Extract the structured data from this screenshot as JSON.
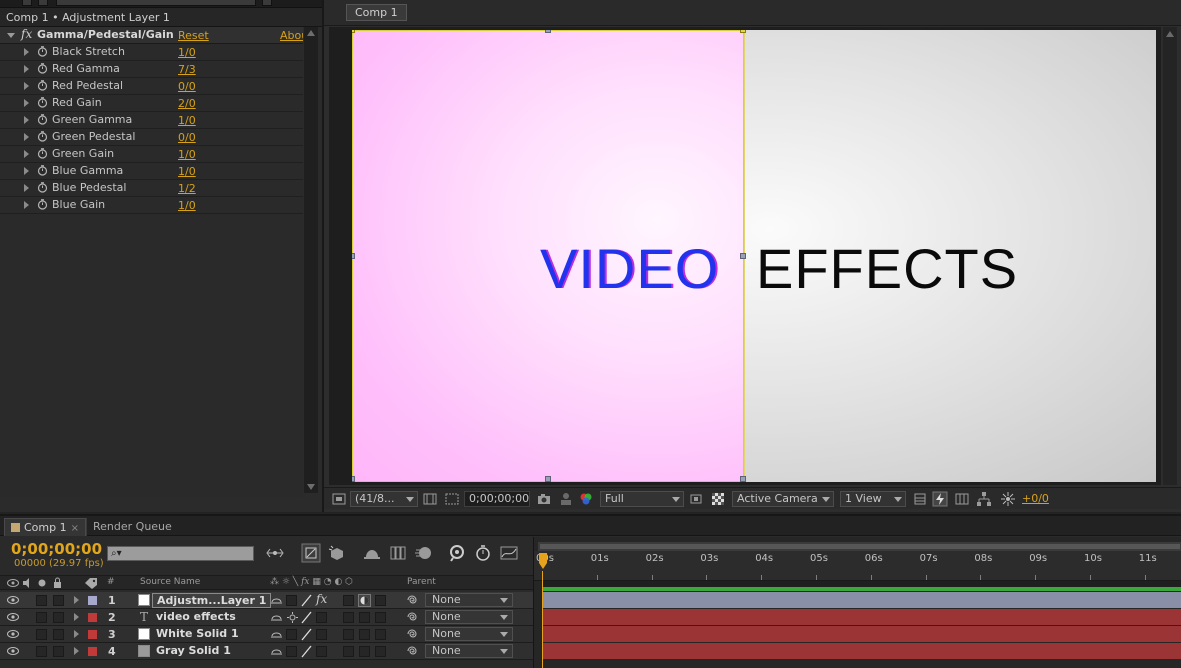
{
  "effect_controls": {
    "panel_title": "Comp 1 • Adjustment Layer 1",
    "effect_name": "Gamma/Pedestal/Gain",
    "reset_label": "Reset",
    "about_label": "Abou",
    "properties": [
      {
        "label": "Black Stretch",
        "value": "1/0"
      },
      {
        "label": "Red Gamma",
        "value": "7/3"
      },
      {
        "label": "Red Pedestal",
        "value": "0/0"
      },
      {
        "label": "Red Gain",
        "value": "2/0"
      },
      {
        "label": "Green Gamma",
        "value": "1/0"
      },
      {
        "label": "Green Pedestal",
        "value": "0/0"
      },
      {
        "label": "Green Gain",
        "value": "1/0"
      },
      {
        "label": "Blue Gamma",
        "value": "1/0"
      },
      {
        "label": "Blue Pedestal",
        "value": "1/2"
      },
      {
        "label": "Blue Gain",
        "value": "1/0"
      }
    ]
  },
  "composition": {
    "tab_label": "Comp 1",
    "canvas_text_left": "VIDEO",
    "canvas_text_right": "EFFECTS",
    "toolbar": {
      "magnification": "(41/8...",
      "timecode": "0;00;00;00",
      "resolution": "Full",
      "camera": "Active Camera",
      "views": "1 View",
      "exposure": "+0/0"
    }
  },
  "timeline": {
    "tab_comp": "Comp 1",
    "tab_render": "Render Queue",
    "current_time": "0;00;00;00",
    "fps_label": "00000 (29.97 fps)",
    "columns": {
      "number": "#",
      "source_name": "Source Name",
      "parent": "Parent"
    },
    "layers": [
      {
        "index": "1",
        "name": "Adjustm...Layer 1",
        "parent": "None",
        "label_color": "#a6a8cc",
        "bar_color": "#8a8fa8"
      },
      {
        "index": "2",
        "name": "video effects",
        "parent": "None",
        "label_color": "#c03a3a",
        "bar_color": "#9b3535"
      },
      {
        "index": "3",
        "name": "White Solid 1",
        "parent": "None",
        "label_color": "#c03a3a",
        "bar_color": "#9b3535"
      },
      {
        "index": "4",
        "name": "Gray Solid 1",
        "parent": "None",
        "label_color": "#c03a3a",
        "bar_color": "#9b3535"
      }
    ],
    "ruler_labels": [
      "00s",
      "01s",
      "02s",
      "03s",
      "04s",
      "05s",
      "06s",
      "07s",
      "08s",
      "09s",
      "10s",
      "11s"
    ]
  },
  "colors": {
    "accent_value": "#d6a21a",
    "selection_yellow": "#d9cf3a",
    "work_area_green": "#3aa83a"
  }
}
